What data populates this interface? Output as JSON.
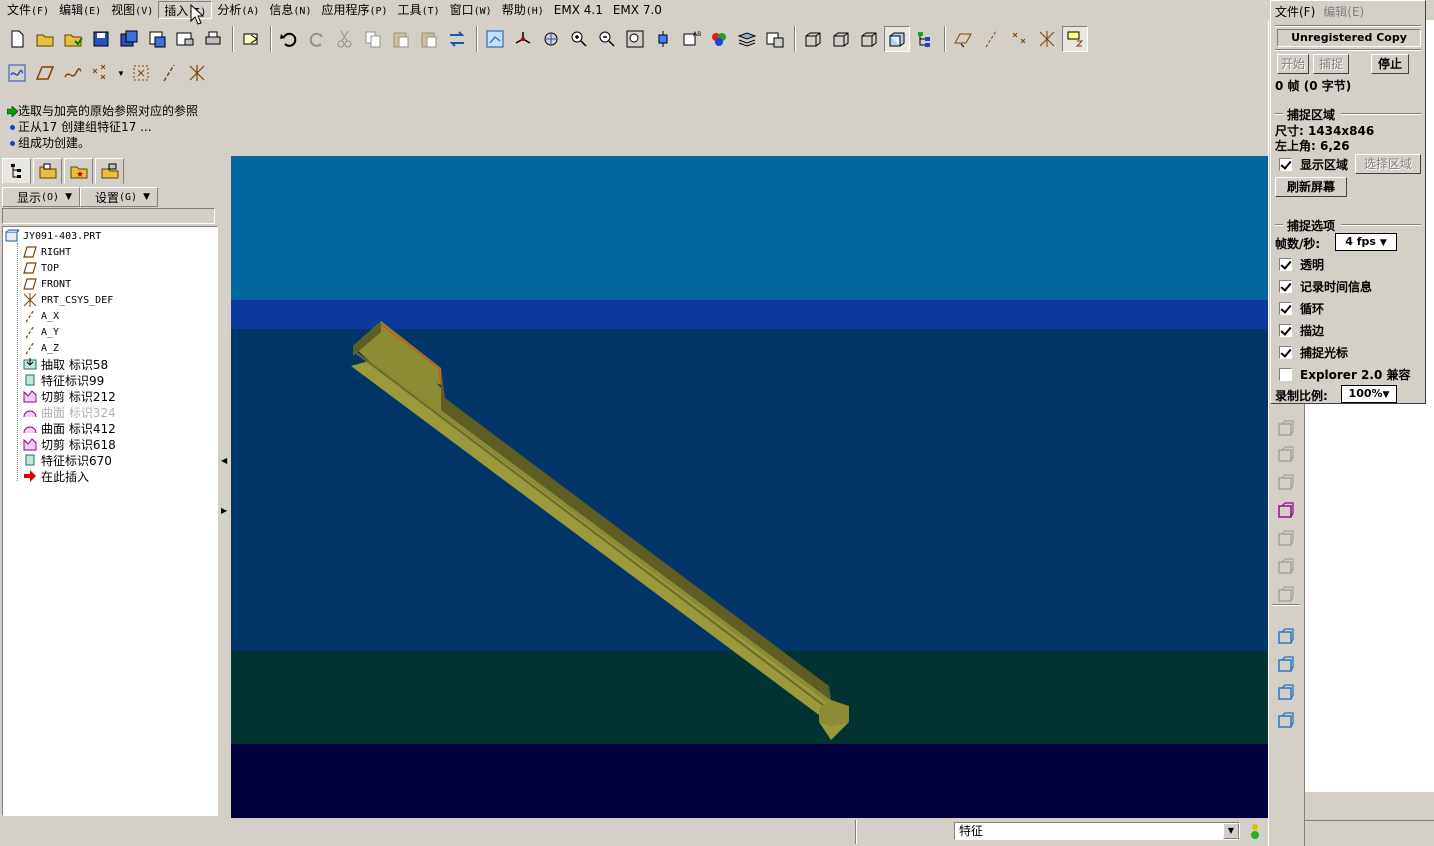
{
  "menubar": {
    "items": [
      {
        "label": "文件",
        "acc": "(F)"
      },
      {
        "label": "编辑",
        "acc": "(E)"
      },
      {
        "label": "视图",
        "acc": "(V)"
      },
      {
        "label": "插入",
        "acc": "(I)"
      },
      {
        "label": "分析",
        "acc": "(A)"
      },
      {
        "label": "信息",
        "acc": "(N)"
      },
      {
        "label": "应用程序",
        "acc": "(P)"
      },
      {
        "label": "工具",
        "acc": "(T)"
      },
      {
        "label": "窗口",
        "acc": "(W)"
      },
      {
        "label": "帮助",
        "acc": "(H)"
      },
      {
        "label": "EMX 4.1",
        "acc": ""
      },
      {
        "label": "EMX 7.0",
        "acc": ""
      }
    ]
  },
  "messages": [
    "选取与加亮的原始参照对应的参照",
    "正从17 创建组特征17 ...",
    "组成功创建。"
  ],
  "tree_panel": {
    "show_label": "显示",
    "show_acc": "(O)",
    "settings_label": "设置",
    "settings_acc": "(G)",
    "nodes": [
      {
        "label": "JY091-403.PRT",
        "icon": "part-icon",
        "mono": true
      },
      {
        "label": "RIGHT",
        "icon": "datum-plane-icon",
        "mono": true
      },
      {
        "label": "TOP",
        "icon": "datum-plane-icon",
        "mono": true
      },
      {
        "label": "FRONT",
        "icon": "datum-plane-icon",
        "mono": true
      },
      {
        "label": "PRT_CSYS_DEF",
        "icon": "csys-icon",
        "mono": true
      },
      {
        "label": "A_X",
        "icon": "datum-axis-icon",
        "mono": true
      },
      {
        "label": "A_Y",
        "icon": "datum-axis-icon",
        "mono": true
      },
      {
        "label": "A_Z",
        "icon": "datum-axis-icon",
        "mono": true
      },
      {
        "label": "抽取 标识58",
        "icon": "extract-icon",
        "mono": false
      },
      {
        "label": "特征标识99",
        "icon": "feature-icon",
        "mono": false
      },
      {
        "label": "切剪 标识212",
        "icon": "cut-icon",
        "mono": false
      },
      {
        "label": "曲面 标识324",
        "icon": "surface-icon",
        "mono": false,
        "dim": true
      },
      {
        "label": "曲面 标识412",
        "icon": "surface-icon",
        "mono": false
      },
      {
        "label": "切剪 标识618",
        "icon": "cut-icon",
        "mono": false
      },
      {
        "label": "特征标识670",
        "icon": "feature-icon",
        "mono": false
      },
      {
        "label": "在此插入",
        "icon": "insert-here-icon",
        "mono": false
      }
    ]
  },
  "statusbar": {
    "filter_value": "特征"
  },
  "capture": {
    "menu_file": "文件(F)",
    "menu_edit": "编辑(E)",
    "title": "Unregistered Copy",
    "start": "开始",
    "capture": "捕捉",
    "stop": "停止",
    "frames": "0 帧 (0 字节)",
    "region_header": "捕捉区域",
    "size": "尺寸: 1434x846",
    "topleft": "左上角: 6,26",
    "show_region": "显示区域",
    "select_region": "选择区域",
    "refresh": "刷新屏幕",
    "options_header": "捕捉选项",
    "fps_label": "帧数/秒:",
    "fps_value": "4 fps",
    "opt_transparent": "透明",
    "opt_timing": "记录时间信息",
    "opt_loop": "循环",
    "opt_outline": "描边",
    "opt_cursor": "捕捉光标",
    "opt_explorer": "Explorer 2.0 兼容",
    "scale_label": "录制比例:",
    "scale_value": "100%"
  },
  "colors": {
    "vp_top": "#03679e",
    "vp_band": "#0b3a9c",
    "vp_mid": "#013467",
    "vp_low": "#013333",
    "vp_floor": "#00003f",
    "part_face": "#9a9a3c",
    "part_top": "#8c8c34",
    "part_dark": "#5e5e22"
  }
}
